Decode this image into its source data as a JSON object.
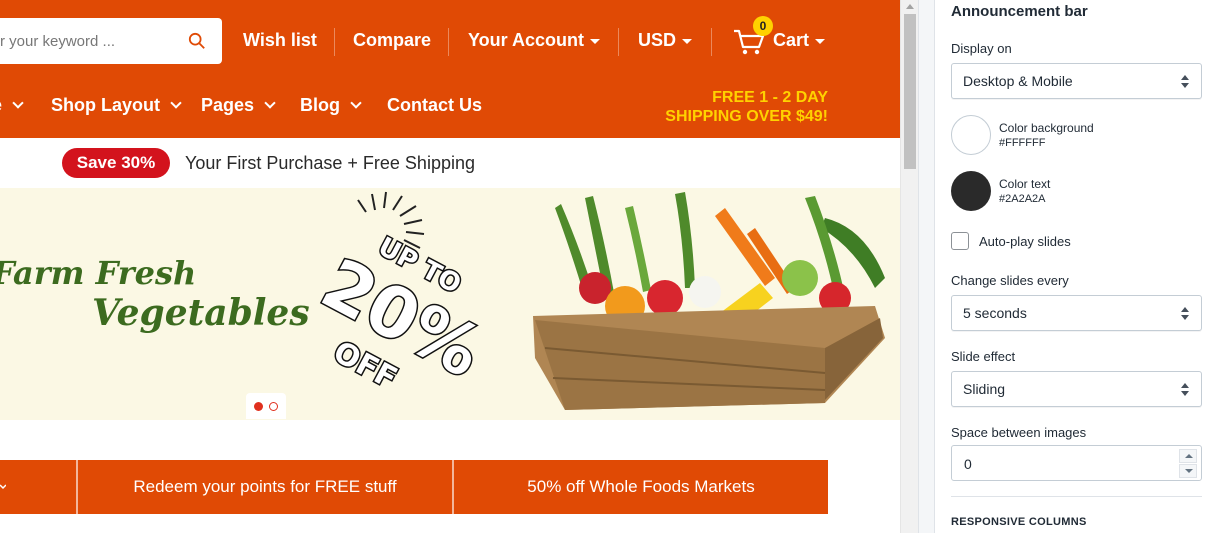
{
  "store": {
    "search": {
      "placeholder": "r your keyword ..."
    },
    "header_links": [
      "Wish list",
      "Compare",
      "Your Account",
      "USD",
      "Cart"
    ],
    "cart_count": "0",
    "main_nav": [
      "e",
      "Shop Layout",
      "Pages",
      "Blog",
      "Contact Us"
    ],
    "promo": {
      "line1": "FREE 1 - 2 DAY",
      "line2": "SHIPPING OVER $49!"
    },
    "announcement": {
      "badge": "Save 30%",
      "text": "Your First Purchase + Free Shipping"
    },
    "slide": {
      "title_line1": "Farm Fresh",
      "title_line2": "Vegetables",
      "offer_top": "UP TO",
      "offer_main": "20%",
      "offer_bottom": "OFF"
    },
    "strip": [
      "Redeem your points for FREE stuff",
      "50% off Whole Foods Markets"
    ],
    "colors": {
      "brand": "#e04a05",
      "promo_text": "#ffd200",
      "badge": "#d3131d"
    }
  },
  "panel": {
    "title": "Announcement bar",
    "display_on": {
      "label": "Display on",
      "value": "Desktop & Mobile"
    },
    "color_background": {
      "label": "Color background",
      "hex": "#FFFFFF"
    },
    "color_text": {
      "label": "Color text",
      "hex": "#2A2A2A"
    },
    "autoplay": {
      "label": "Auto-play slides",
      "checked": false
    },
    "change_slides": {
      "label": "Change slides every",
      "value": "5 seconds"
    },
    "slide_effect": {
      "label": "Slide effect",
      "value": "Sliding"
    },
    "space_between": {
      "label": "Space between images",
      "value": "0"
    },
    "next_section": "RESPONSIVE COLUMNS"
  }
}
